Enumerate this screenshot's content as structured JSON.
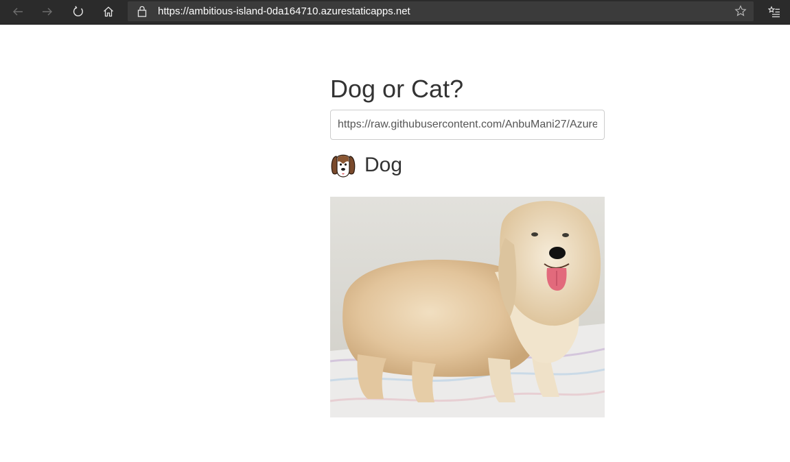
{
  "browser": {
    "url": "https://ambitious-island-0da164710.azurestaticapps.net"
  },
  "page": {
    "title": "Dog or Cat?",
    "image_url_value": "https://raw.githubusercontent.com/AnbuMani27/Azure",
    "prediction": "Dog",
    "prediction_icon": "dog-face-icon"
  }
}
